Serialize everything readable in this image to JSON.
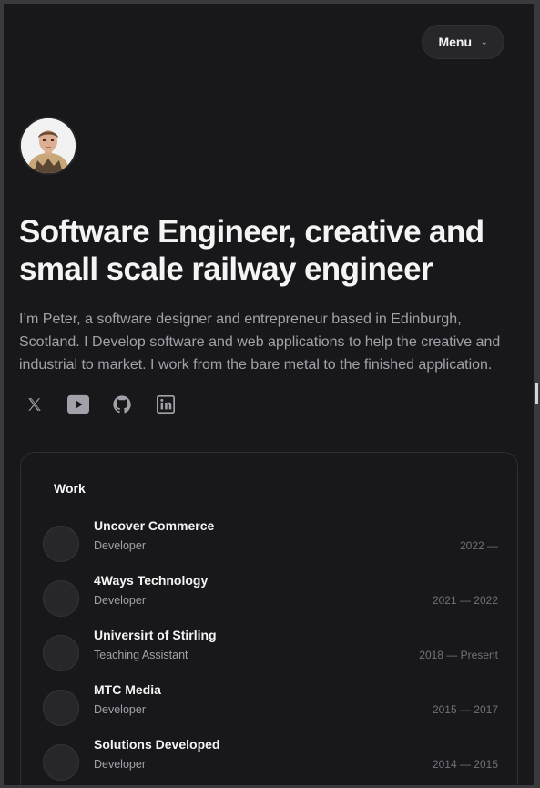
{
  "header": {
    "menu_label": "Menu"
  },
  "hero": {
    "headline": "Software Engineer, creative and small scale railway engineer",
    "intro": "I’m Peter, a software designer and entrepreneur based in Edinburgh, Scotland. I Develop software and web applications to help the creative and industrial to market. I work from the bare metal to the finished application."
  },
  "socials": [
    {
      "icon": "x-icon"
    },
    {
      "icon": "youtube-icon"
    },
    {
      "icon": "github-icon"
    },
    {
      "icon": "linkedin-icon"
    }
  ],
  "work": {
    "title": "Work",
    "jobs": [
      {
        "company": "Uncover Commerce",
        "role": "Developer",
        "dates": "2022 —"
      },
      {
        "company": "4Ways Technology",
        "role": "Developer",
        "dates": "2021 — 2022"
      },
      {
        "company": "Universirt of Stirling",
        "role": "Teaching Assistant",
        "dates": "2018 — Present"
      },
      {
        "company": "MTC Media",
        "role": "Developer",
        "dates": "2015 — 2017"
      },
      {
        "company": "Solutions Developed",
        "role": "Developer",
        "dates": "2014 — 2015"
      }
    ]
  },
  "colors": {
    "background": "#18181b",
    "text_primary": "#f4f4f5",
    "text_secondary": "#a1a1aa",
    "icon": "#a1a1aa"
  }
}
